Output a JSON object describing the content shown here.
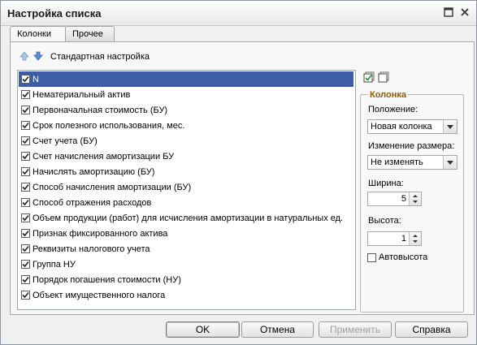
{
  "window": {
    "title": "Настройка списка"
  },
  "tabs": [
    {
      "label": "Колонки",
      "active": true
    },
    {
      "label": "Прочее",
      "active": false
    }
  ],
  "toolbar": {
    "up_icon": "arrow-up-icon",
    "down_icon": "arrow-down-icon",
    "standard_label": "Стандартная настройка"
  },
  "columns": [
    {
      "label": "N",
      "checked": true,
      "selected": true
    },
    {
      "label": "Нематериальный актив",
      "checked": true
    },
    {
      "label": "Первоначальная стоимость (БУ)",
      "checked": true
    },
    {
      "label": "Срок полезного использования, мес.",
      "checked": true
    },
    {
      "label": "Счет учета (БУ)",
      "checked": true
    },
    {
      "label": "Счет начисления амортизации БУ",
      "checked": true
    },
    {
      "label": "Начислять амортизацию (БУ)",
      "checked": true
    },
    {
      "label": "Способ начисления амортизации (БУ)",
      "checked": true
    },
    {
      "label": "Способ отражения расходов",
      "checked": true
    },
    {
      "label": "Объем продукции (работ) для исчисления амортизации в натуральных ед.",
      "checked": true
    },
    {
      "label": "Признак фиксированного актива",
      "checked": true
    },
    {
      "label": "Реквизиты налогового учета",
      "checked": true
    },
    {
      "label": "Группа НУ",
      "checked": true
    },
    {
      "label": "Порядок погашения стоимости (НУ)",
      "checked": true
    },
    {
      "label": "Объект имущественного налога",
      "checked": true
    }
  ],
  "column_panel": {
    "title": "Колонка",
    "position_label": "Положение:",
    "position_value": "Новая колонка",
    "resize_label": "Изменение размера:",
    "resize_value": "Не изменять",
    "width_label": "Ширина:",
    "width_value": "5",
    "height_label": "Высота:",
    "height_value": "1",
    "autoheight_label": "Автовысота",
    "autoheight_checked": false
  },
  "buttons": {
    "ok": "OK",
    "cancel": "Отмена",
    "apply": "Применить",
    "help": "Справка"
  },
  "colors": {
    "selection": "#3d5da6",
    "group_title": "#8b5a00"
  }
}
